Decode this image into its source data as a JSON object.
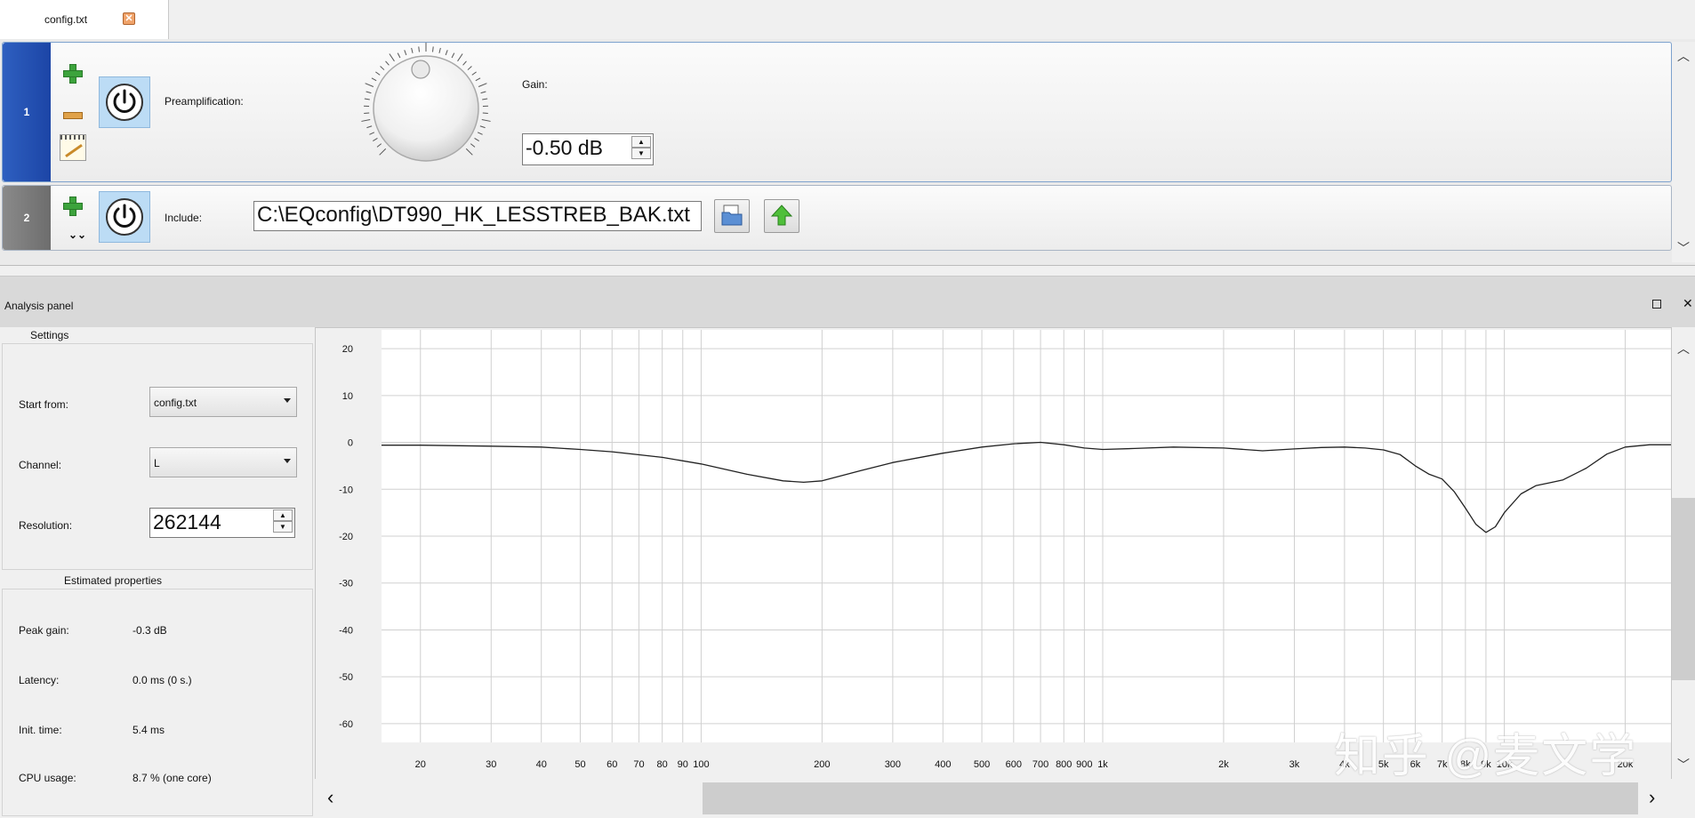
{
  "tab": {
    "title": "config.txt",
    "close_symbol": "✕"
  },
  "rows": [
    {
      "number": "1",
      "type_label": "Preamplification:",
      "gain_label": "Gain:",
      "gain_value": "-0.50 dB"
    },
    {
      "number": "2",
      "type_label": "Include:",
      "path": "C:\\EQconfig\\DT990_HK_LESSTREB_BAK.txt",
      "collapse_symbol": "⌄⌄"
    }
  ],
  "analysis": {
    "title": "Analysis panel",
    "float_symbol": "",
    "close_symbol": "✕",
    "settings": {
      "title": "Settings",
      "start_from_label": "Start from:",
      "start_from_value": "config.txt",
      "channel_label": "Channel:",
      "channel_value": "L",
      "resolution_label": "Resolution:",
      "resolution_value": "262144"
    },
    "estimated": {
      "title": "Estimated properties",
      "peak_gain_label": "Peak gain:",
      "peak_gain_value": "-0.3 dB",
      "latency_label": "Latency:",
      "latency_value": "0.0 ms (0 s.)",
      "init_time_label": "Init. time:",
      "init_time_value": "5.4 ms",
      "cpu_usage_label": "CPU usage:",
      "cpu_usage_value": "8.7 % (one core)"
    }
  },
  "watermark": "知乎 @麦文学",
  "scroll_symbols": {
    "up": "︿",
    "down": "﹀",
    "left": "‹",
    "right": "›"
  },
  "colors": {
    "accent_row": "#2e5fc0",
    "inactive_row": "#7a7a7a",
    "curve": "#222222",
    "grid": "#d0d0d0"
  },
  "chart_data": {
    "type": "line",
    "title": "",
    "xlabel": "",
    "ylabel": "",
    "x_scale": "log",
    "xlim": [
      16,
      26000
    ],
    "ylim": [
      -64,
      24
    ],
    "grid": true,
    "y_ticks": [
      "20",
      "10",
      "0",
      "-10",
      "-20",
      "-30",
      "-40",
      "-50",
      "-60"
    ],
    "x_ticks": [
      {
        "f": 20,
        "label": "20"
      },
      {
        "f": 30,
        "label": "30"
      },
      {
        "f": 40,
        "label": "40"
      },
      {
        "f": 50,
        "label": "50"
      },
      {
        "f": 60,
        "label": "60"
      },
      {
        "f": 70,
        "label": "70"
      },
      {
        "f": 80,
        "label": "80"
      },
      {
        "f": 90,
        "label": "90"
      },
      {
        "f": 100,
        "label": "100"
      },
      {
        "f": 200,
        "label": "200"
      },
      {
        "f": 300,
        "label": "300"
      },
      {
        "f": 400,
        "label": "400"
      },
      {
        "f": 500,
        "label": "500"
      },
      {
        "f": 600,
        "label": "600"
      },
      {
        "f": 700,
        "label": "700"
      },
      {
        "f": 800,
        "label": "800"
      },
      {
        "f": 900,
        "label": "900"
      },
      {
        "f": 1000,
        "label": "1k"
      },
      {
        "f": 2000,
        "label": "2k"
      },
      {
        "f": 3000,
        "label": "3k"
      },
      {
        "f": 4000,
        "label": "4k"
      },
      {
        "f": 5000,
        "label": "5k"
      },
      {
        "f": 6000,
        "label": "6k"
      },
      {
        "f": 7000,
        "label": "7k"
      },
      {
        "f": 8000,
        "label": "8k"
      },
      {
        "f": 9000,
        "label": "9k"
      },
      {
        "f": 10000,
        "label": "10k"
      },
      {
        "f": 20000,
        "label": "20k"
      }
    ],
    "series": [
      {
        "x": [
          16,
          20,
          30,
          40,
          50,
          60,
          80,
          100,
          130,
          160,
          180,
          200,
          250,
          300,
          400,
          500,
          600,
          700,
          800,
          900,
          1000,
          1200,
          1500,
          2000,
          2500,
          3000,
          3500,
          4000,
          4500,
          5000,
          5500,
          6000,
          6500,
          7000,
          7500,
          8000,
          8500,
          9000,
          9500,
          10000,
          11000,
          12000,
          13000,
          14000,
          16000,
          18000,
          20000,
          23000,
          26000
        ],
        "y": [
          -0.6,
          -0.6,
          -0.8,
          -1.0,
          -1.5,
          -2.0,
          -3.2,
          -4.6,
          -6.8,
          -8.2,
          -8.5,
          -8.2,
          -6.0,
          -4.3,
          -2.3,
          -1.0,
          -0.3,
          0.0,
          -0.5,
          -1.2,
          -1.5,
          -1.3,
          -1.0,
          -1.2,
          -1.8,
          -1.4,
          -1.1,
          -1.0,
          -1.2,
          -1.6,
          -2.6,
          -5.0,
          -6.8,
          -7.8,
          -10.5,
          -14.0,
          -17.5,
          -19.2,
          -18.0,
          -15.0,
          -11.0,
          -9.2,
          -8.6,
          -8.0,
          -5.5,
          -2.5,
          -1.0,
          -0.5,
          -0.5
        ]
      }
    ]
  }
}
